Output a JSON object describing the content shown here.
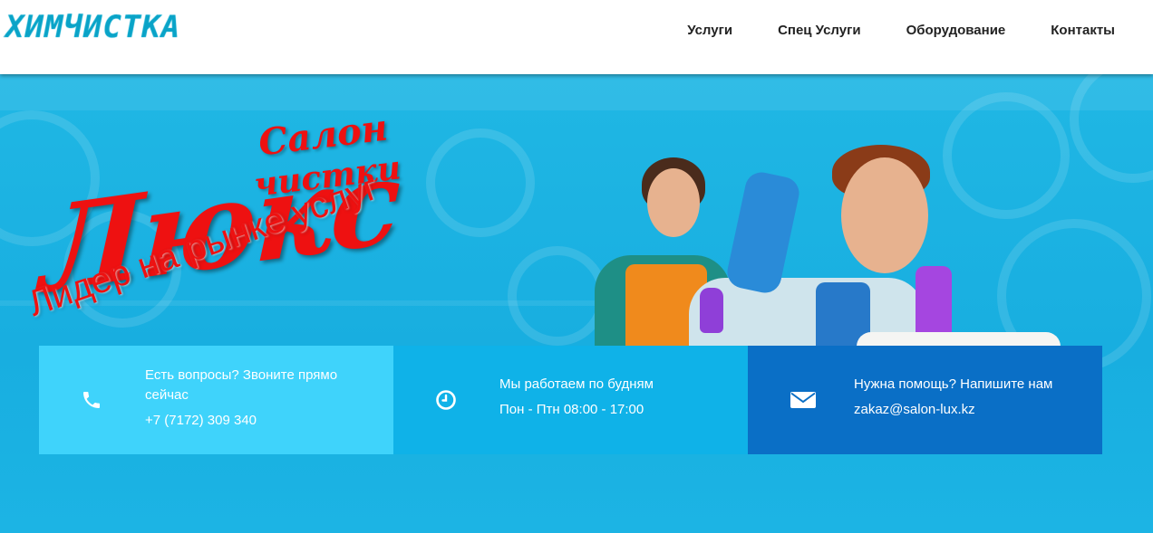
{
  "header": {
    "logo_text": "ХИМЧИСТКА",
    "nav": [
      {
        "label": "Услуги"
      },
      {
        "label": "Спец Услуги"
      },
      {
        "label": "Оборудование"
      },
      {
        "label": "Контакты"
      }
    ]
  },
  "hero": {
    "brand_line1": "Салон",
    "brand_line2": "чистки",
    "brand_main": "Люкс",
    "tagline": "Лидер на рынке услуг"
  },
  "info": [
    {
      "icon": "phone-icon",
      "title": "Есть вопросы? Звоните прямо сейчас",
      "detail": "+7 (7172) 309 340",
      "color": "#3fd3fb"
    },
    {
      "icon": "clock-icon",
      "title": "Мы работаем по будням",
      "detail": "Пон - Птн 08:00 - 17:00",
      "color": "#0fb2e8"
    },
    {
      "icon": "envelope-icon",
      "title": "Нужна помощь? Напишите нам",
      "detail": "zakaz@salon-lux.kz",
      "color": "#0a6fc6"
    }
  ],
  "colors": {
    "accent": "#1ec6e6",
    "brand_red": "#ee1111",
    "hero_bg": "#18aee0"
  }
}
